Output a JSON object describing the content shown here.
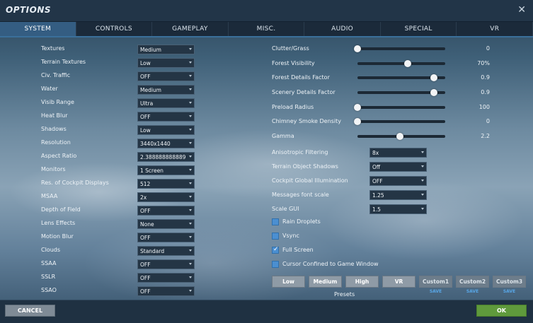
{
  "window": {
    "title": "OPTIONS",
    "close_icon": "close-icon"
  },
  "tabs": [
    {
      "label": "SYSTEM",
      "active": true
    },
    {
      "label": "CONTROLS",
      "active": false
    },
    {
      "label": "GAMEPLAY",
      "active": false
    },
    {
      "label": "MISC.",
      "active": false
    },
    {
      "label": "AUDIO",
      "active": false
    },
    {
      "label": "SPECIAL",
      "active": false
    },
    {
      "label": "VR",
      "active": false
    }
  ],
  "left_settings": [
    {
      "label": "Textures",
      "value": "Medium"
    },
    {
      "label": "Terrain Textures",
      "value": "Low"
    },
    {
      "label": "Civ. Traffic",
      "value": "OFF"
    },
    {
      "label": "Water",
      "value": "Medium"
    },
    {
      "label": "Visib Range",
      "value": "Ultra"
    },
    {
      "label": "Heat Blur",
      "value": "OFF"
    },
    {
      "label": "Shadows",
      "value": "Low"
    },
    {
      "label": "Resolution",
      "value": "3440x1440"
    },
    {
      "label": "Aspect Ratio",
      "value": "2.388888888889"
    },
    {
      "label": "Monitors",
      "value": "1 Screen"
    },
    {
      "label": "Res. of Cockpit Displays",
      "value": "512"
    },
    {
      "label": "MSAA",
      "value": "2x"
    },
    {
      "label": "Depth of Field",
      "value": "OFF"
    },
    {
      "label": "Lens Effects",
      "value": "None"
    },
    {
      "label": "Motion Blur",
      "value": "OFF"
    },
    {
      "label": "Clouds",
      "value": "Standard"
    },
    {
      "label": "SSAA",
      "value": "OFF"
    },
    {
      "label": "SSLR",
      "value": "OFF"
    },
    {
      "label": "SSAO",
      "value": "OFF"
    }
  ],
  "sliders": [
    {
      "label": "Clutter/Grass",
      "value": "0",
      "level": 0.0
    },
    {
      "label": "Forest Visibility",
      "value": "70%",
      "level": 0.57
    },
    {
      "label": "Forest Details Factor",
      "value": "0.9",
      "level": 0.87
    },
    {
      "label": "Scenery Details Factor",
      "value": "0.9",
      "level": 0.87
    },
    {
      "label": "Preload Radius",
      "value": "100",
      "level": 0.0
    },
    {
      "label": "Chimney Smoke Density",
      "value": "0",
      "level": 0.0
    },
    {
      "label": "Gamma",
      "value": "2.2",
      "level": 0.48
    }
  ],
  "right_dropdowns": [
    {
      "label": "Anisotropic Filtering",
      "value": "8x"
    },
    {
      "label": "Terrain Object Shadows",
      "value": "Off"
    },
    {
      "label": "Cockpit Global Illumination",
      "value": "OFF"
    },
    {
      "label": "Messages font scale",
      "value": "1.25"
    },
    {
      "label": "Scale GUI",
      "value": "1.5"
    }
  ],
  "checkboxes": [
    {
      "label": "Rain Droplets",
      "checked": false
    },
    {
      "label": "Vsync",
      "checked": false
    },
    {
      "label": "Full Screen",
      "checked": true
    },
    {
      "label": "Cursor Confined to Game Window",
      "checked": false
    }
  ],
  "presets": {
    "title": "Presets",
    "buttons": [
      "Low",
      "Medium",
      "High",
      "VR"
    ],
    "custom": [
      "Custom1",
      "Custom2",
      "Custom3"
    ],
    "save_label": "SAVE"
  },
  "footer": {
    "cancel": "CANCEL",
    "ok": "OK"
  }
}
